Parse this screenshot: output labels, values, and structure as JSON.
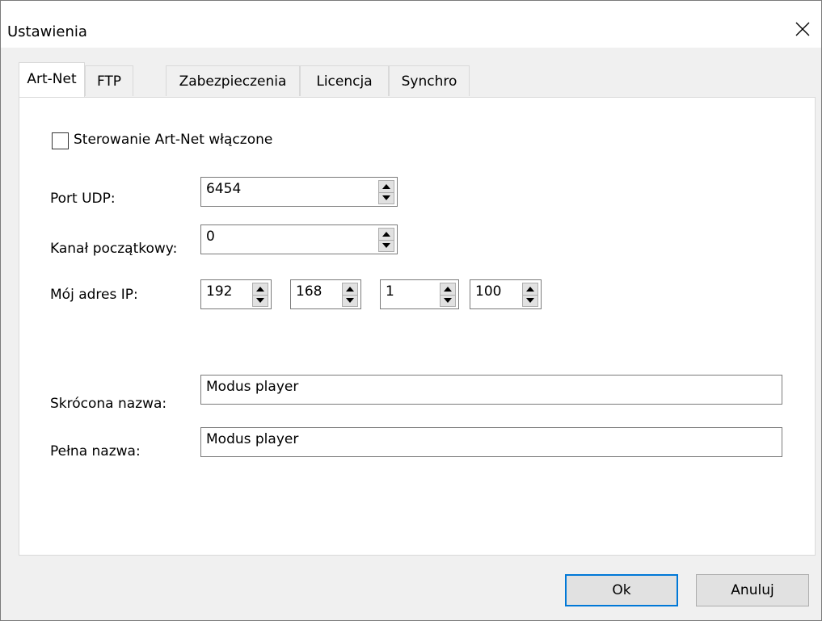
{
  "window": {
    "title": "Ustawienia"
  },
  "tabs": [
    {
      "label": "Art-Net",
      "active": true
    },
    {
      "label": "FTP"
    },
    {
      "label": "Zabezpieczenia"
    },
    {
      "label": "Licencja"
    },
    {
      "label": "Synchro"
    }
  ],
  "artnet": {
    "enabled_label": "Sterowanie Art-Net włączone",
    "enabled": false,
    "udp_port_label": "Port UDP:",
    "udp_port": "6454",
    "start_channel_label": "Kanał początkowy:",
    "start_channel": "0",
    "ip_label": "Mój adres IP:",
    "ip": [
      "192",
      "168",
      "1",
      "100"
    ],
    "short_name_label": "Skrócona nazwa:",
    "short_name": "Modus player",
    "full_name_label": "Pełna nazwa:",
    "full_name": "Modus player"
  },
  "buttons": {
    "ok": "Ok",
    "cancel": "Anuluj"
  },
  "icons": {
    "close": "close-icon",
    "spin_up": "arrow-up-icon",
    "spin_down": "arrow-down-icon"
  },
  "colors": {
    "accent": "#0078d7",
    "panel": "#ffffff",
    "dialog": "#f0f0f0"
  }
}
